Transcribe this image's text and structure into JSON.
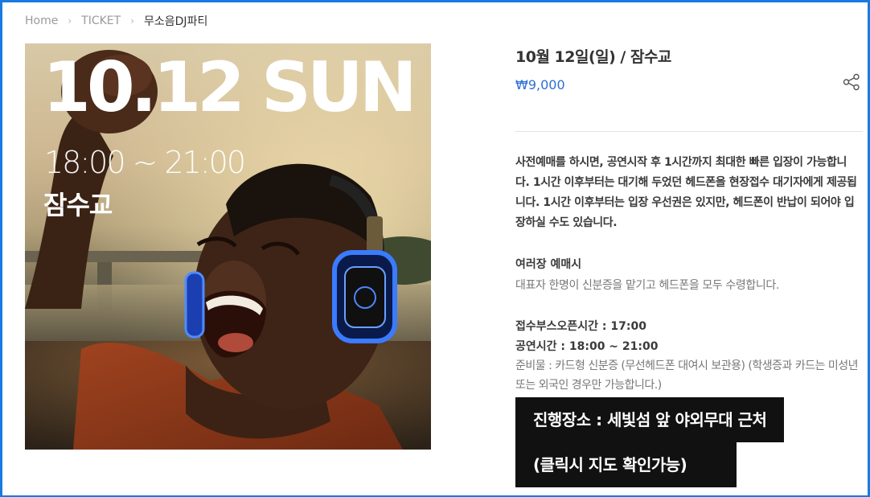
{
  "breadcrumb": {
    "home": "Home",
    "section": "TICKET",
    "current": "무소음DJ파티"
  },
  "poster": {
    "date": "10.12 SUN",
    "time": "18:00 ~ 21:00",
    "place": "잠수교"
  },
  "product": {
    "title": "10월 12일(일) / 잠수교",
    "price": "₩9,000",
    "description": "사전예매를 하시면, 공연시작 후 1시간까지 최대한 빠른 입장이 가능합니다. 1시간 이후부터는 대기해 두었던 헤드폰을 현장접수 대기자에게 제공됩니다. 1시간 이후부터는 입장 우선권은 있지만, 헤드폰이 반납이 되어야 입장하실 수도 있습니다.",
    "group_title": "여러장 예매시",
    "group_text": "대표자 한명이 신분증을 맡기고 헤드폰을 모두 수령합니다.",
    "booth_open": "접수부스오픈시간 : 17:00",
    "show_time": "공연시간 : 18:00 ~ 21:00",
    "preparation": "준비물 : 카드형 신분증 (무선헤드폰 대여시 보관용) (학생증과 카드는 미성년 또는 외국인 경우만 가능합니다.)",
    "venue_line1": "진행장소 : 세빛섬 앞 야외무대 근처",
    "venue_line2": "(클릭시 지도 확인가능)"
  },
  "icons": {
    "share": "share-icon",
    "chevron": "chevron-right-icon"
  },
  "colors": {
    "frame": "#1a7ae0",
    "price": "#2f6fd6",
    "banner_bg": "#111111"
  }
}
